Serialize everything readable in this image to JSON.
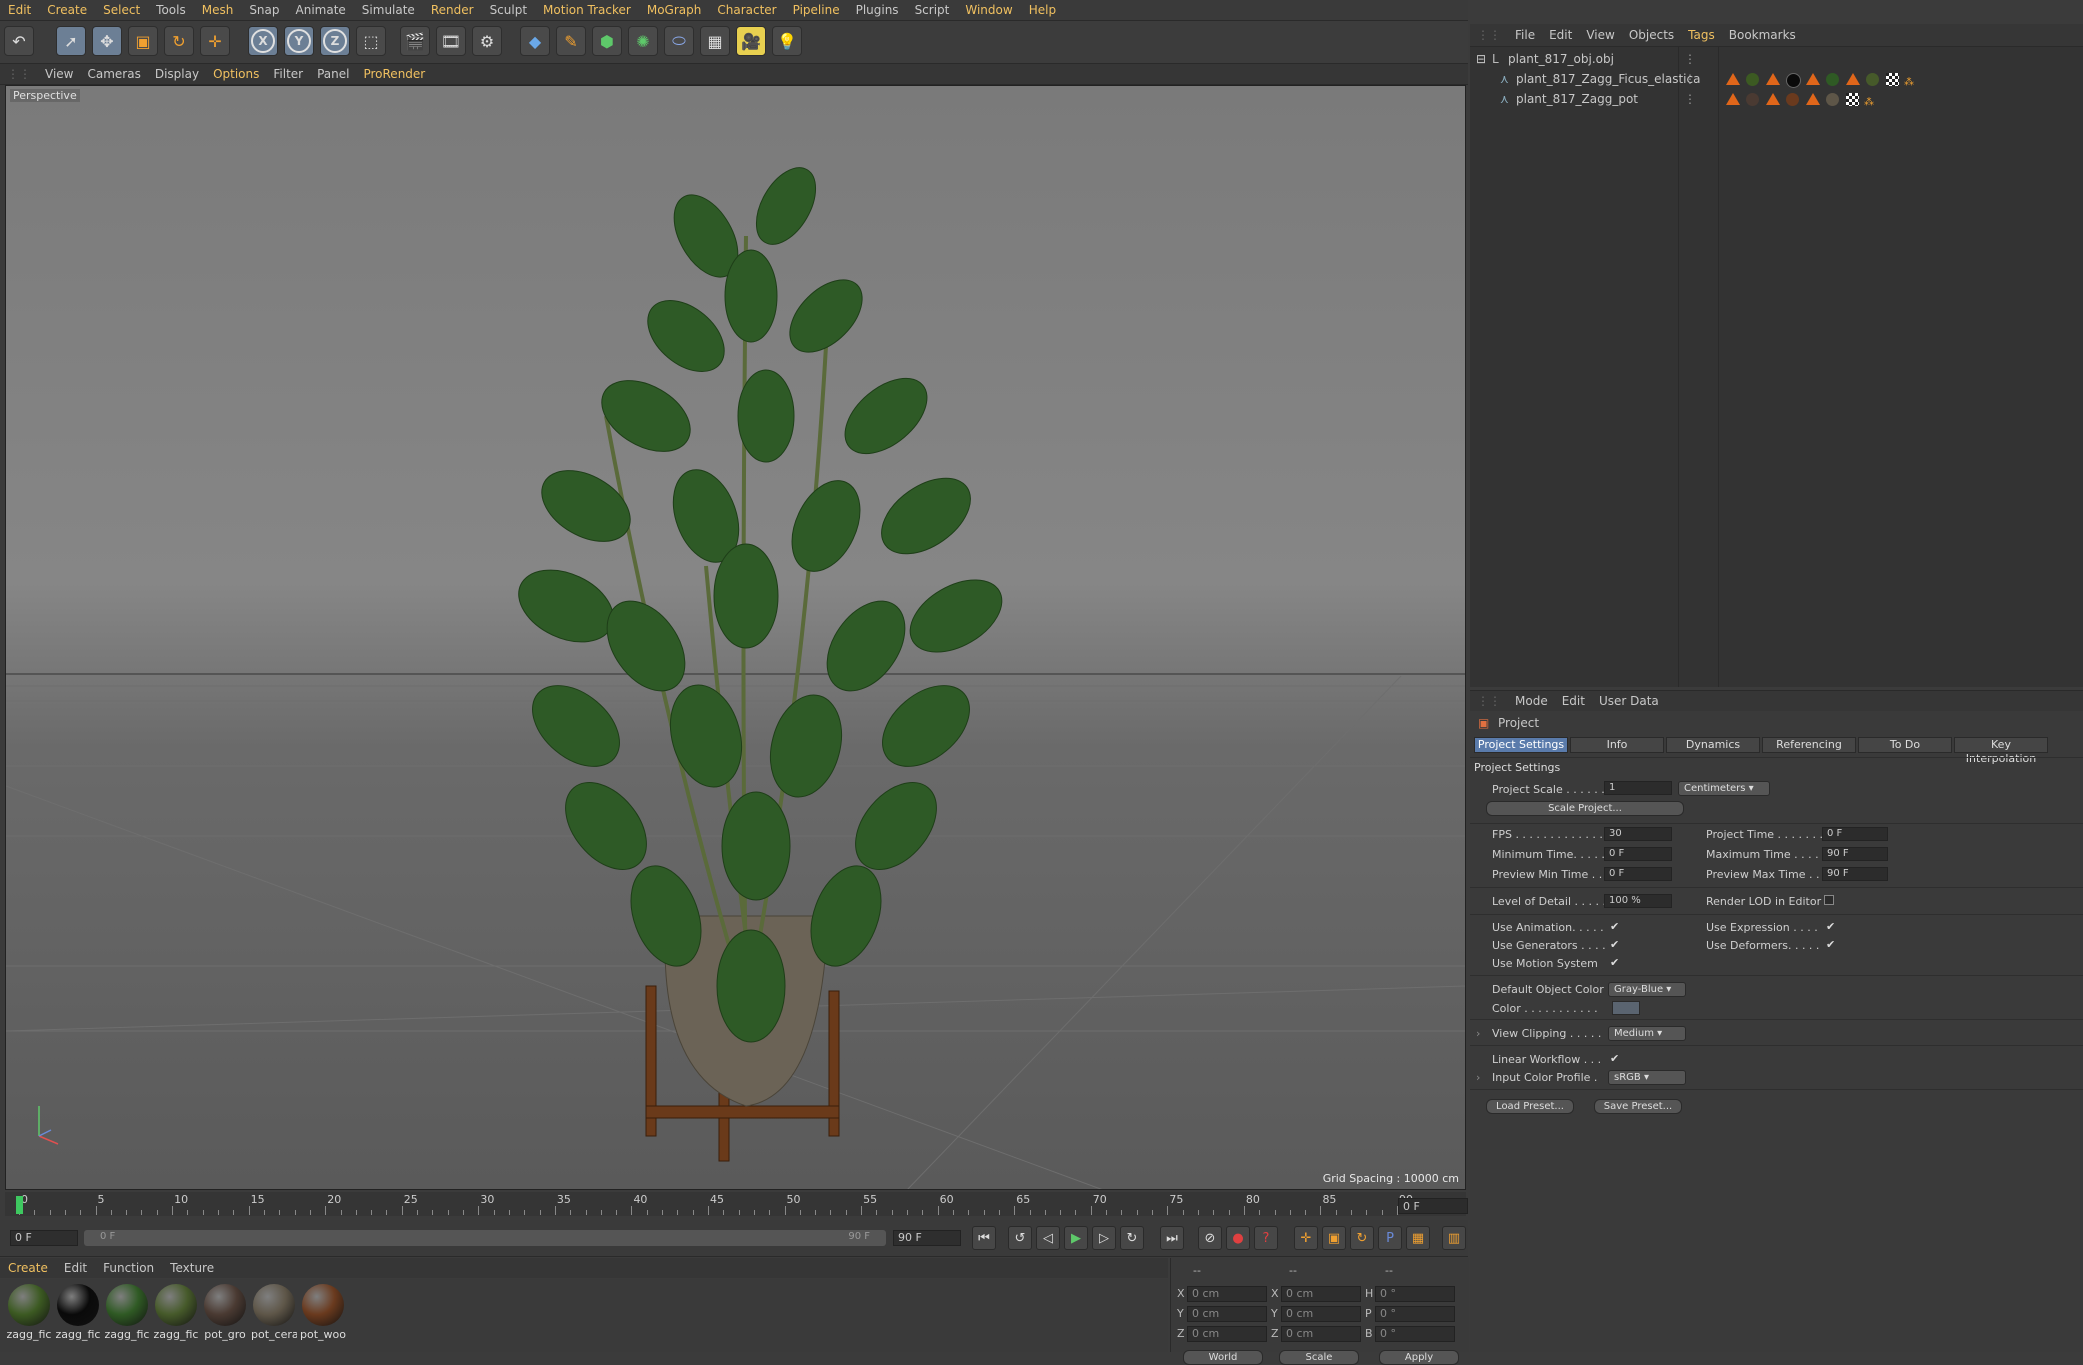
{
  "menubar": [
    "Edit",
    "Create",
    "Select",
    "Tools",
    "Mesh",
    "Snap",
    "Animate",
    "Simulate",
    "Render",
    "Sculpt",
    "Motion Tracker",
    "MoGraph",
    "Character",
    "Pipeline",
    "Plugins",
    "Script",
    "Window",
    "Help"
  ],
  "viewport_menu": [
    "View",
    "Cameras",
    "Display",
    "Options",
    "Filter",
    "Panel",
    "ProRender"
  ],
  "viewport": {
    "label": "Perspective",
    "grid_spacing": "Grid Spacing : 10000 cm"
  },
  "timeline": {
    "ticks": [
      "0",
      "5",
      "10",
      "15",
      "20",
      "25",
      "30",
      "35",
      "40",
      "45",
      "50",
      "55",
      "60",
      "65",
      "70",
      "75",
      "80",
      "85",
      "90"
    ],
    "current_frame": "0 F",
    "start_field": "0 F",
    "range_start": "0 F",
    "range_end": "90 F",
    "end_field": "90 F"
  },
  "materials_menu": [
    "Create",
    "Edit",
    "Function",
    "Texture"
  ],
  "materials": [
    {
      "name": "zagg_fic",
      "color": "#3c5a22"
    },
    {
      "name": "zagg_fic",
      "color": "#0a0a0a"
    },
    {
      "name": "zagg_fic",
      "color": "#2f5a24"
    },
    {
      "name": "zagg_fic",
      "color": "#465a2a"
    },
    {
      "name": "pot_gro",
      "color": "#4a3a32"
    },
    {
      "name": "pot_cera",
      "color": "#5e5648"
    },
    {
      "name": "pot_woo",
      "color": "#6a3a1e"
    }
  ],
  "coordinates": {
    "rows": [
      {
        "a": "X",
        "av": "0 cm",
        "b": "X",
        "bv": "0 cm",
        "c": "H",
        "cv": "0 °"
      },
      {
        "a": "Y",
        "av": "0 cm",
        "b": "Y",
        "bv": "0 cm",
        "c": "P",
        "cv": "0 °"
      },
      {
        "a": "Z",
        "av": "0 cm",
        "b": "Z",
        "bv": "0 cm",
        "c": "B",
        "cv": "0 °"
      }
    ],
    "mode": "World",
    "scale_mode": "Scale",
    "apply": "Apply",
    "dashes": [
      "--",
      "--",
      "--"
    ]
  },
  "object_manager": {
    "menu": [
      "File",
      "Edit",
      "View",
      "Objects",
      "Tags",
      "Bookmarks"
    ],
    "objects": [
      {
        "name": "plant_817_obj.obj"
      },
      {
        "name": "plant_817_Zagg_Ficus_elastica"
      },
      {
        "name": "plant_817_Zagg_pot"
      }
    ]
  },
  "attributes": {
    "menu": [
      "Mode",
      "Edit",
      "User Data"
    ],
    "title": "Project",
    "tabs": [
      "Project Settings",
      "Info",
      "Dynamics",
      "Referencing",
      "To Do",
      "Key Interpolation"
    ],
    "section": "Project Settings",
    "project_scale_label": "Project Scale . . . . . .",
    "project_scale_value": "1",
    "project_scale_unit": "Centimeters",
    "scale_project_button": "Scale Project...",
    "fps_label": "FPS . . . . . . . . . . . . . .",
    "fps_value": "30",
    "project_time_label": "Project Time . . . . . . . .",
    "project_time_value": "0 F",
    "min_time_label": "Minimum Time. . . . .",
    "min_time_value": "0 F",
    "max_time_label": "Maximum Time . . . .",
    "max_time_value": "90 F",
    "prev_min_label": "Preview Min Time . .",
    "prev_min_value": "0 F",
    "prev_max_label": "Preview Max Time . .",
    "prev_max_value": "90 F",
    "lod_label": "Level of Detail . . . . .",
    "lod_value": "100 %",
    "render_lod_label": "Render LOD in Editor",
    "use_anim_label": "Use Animation. . . . .",
    "use_expr_label": "Use Expression . . . .",
    "use_gen_label": "Use Generators . . . .",
    "use_def_label": "Use Deformers. . . . .",
    "use_motion_label": "Use Motion System",
    "default_color_label": "Default Object Color",
    "default_color_value": "Gray-Blue",
    "color_label": "Color . . . . . . . . . . .",
    "view_clipping_label": "View Clipping . . . . .",
    "view_clipping_value": "Medium",
    "linear_label": "Linear Workflow . . .",
    "input_profile_label": "Input Color Profile .",
    "input_profile_value": "sRGB",
    "load_preset": "Load Preset...",
    "save_preset": "Save Preset..."
  }
}
